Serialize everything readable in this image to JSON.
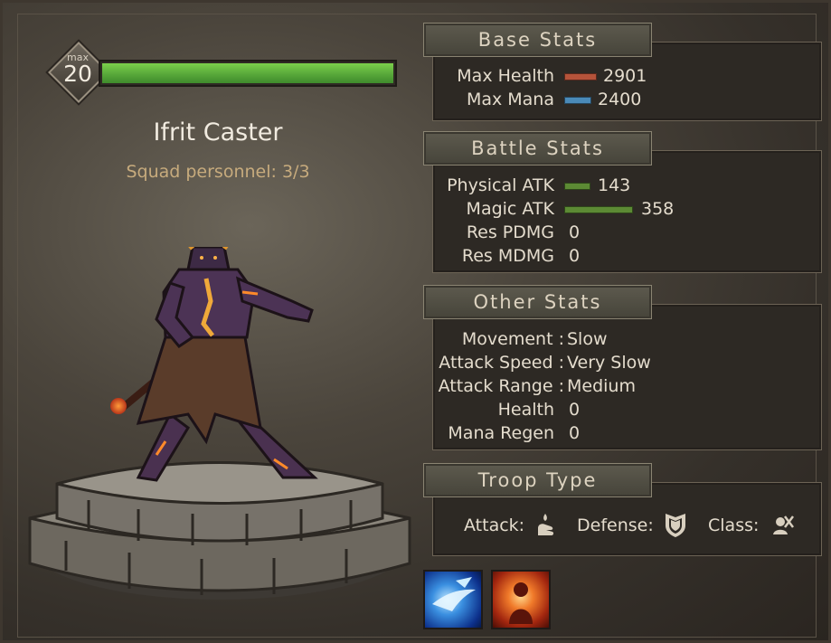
{
  "level": {
    "max_label": "max",
    "value": "20",
    "progress": 1.0
  },
  "unit": {
    "name": "Ifrit Caster",
    "squad": "Squad personnel: 3/3"
  },
  "base_stats": {
    "title": "Base Stats",
    "max_health": {
      "label": "Max Health",
      "value": "2901",
      "color": "#b5533a"
    },
    "max_mana": {
      "label": "Max Mana",
      "value": "2400",
      "color": "#4a8ab8"
    }
  },
  "battle_stats": {
    "title": "Battle Stats",
    "physical_atk": {
      "label": "Physical ATK",
      "value": "143",
      "color": "#5c8a34"
    },
    "magic_atk": {
      "label": "Magic ATK",
      "value": "358",
      "color": "#5c8a34"
    },
    "res_pdmg": {
      "label": "Res PDMG",
      "value": "0"
    },
    "res_mdmg": {
      "label": "Res MDMG",
      "value": "0"
    }
  },
  "other_stats": {
    "title": "Other Stats",
    "movement": {
      "label": "Movement :",
      "value": "Slow"
    },
    "attack_speed": {
      "label": "Attack Speed :",
      "value": "Very Slow"
    },
    "attack_range": {
      "label": "Attack Range :",
      "value": "Medium"
    },
    "health": {
      "label": "Health",
      "value": "0"
    },
    "mana_regen": {
      "label": "Mana Regen",
      "value": "0"
    }
  },
  "troop_type": {
    "title": "Troop Type",
    "attack_label": "Attack:",
    "defense_label": "Defense:",
    "class_label": "Class:",
    "attack_icon": "magic-hand-icon",
    "defense_icon": "shield-icon",
    "class_icon": "crossed-caster-icon"
  },
  "skills": [
    {
      "icon": "ice-wave-skill-icon"
    },
    {
      "icon": "fire-burst-skill-icon"
    }
  ]
}
